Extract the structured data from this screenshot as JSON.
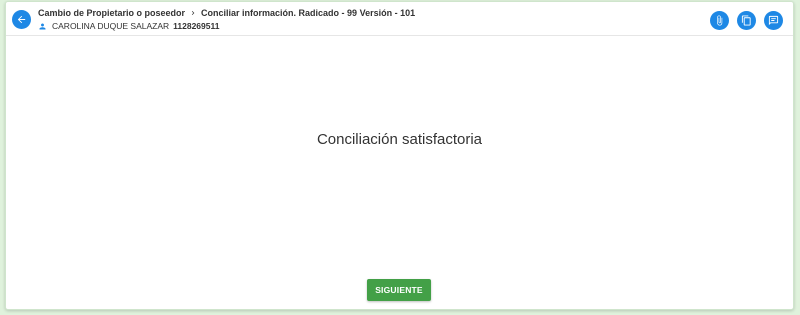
{
  "header": {
    "breadcrumb": {
      "first": "Cambio de Propietario o poseedor",
      "second": "Conciliar información. Radicado - 99 Versión - 101"
    },
    "user": {
      "name": "CAROLINA DUQUE SALAZAR",
      "document": "1128269511"
    },
    "icons": {
      "back": "arrow-left-icon",
      "attach": "paperclip-icon",
      "copy": "copy-icon",
      "comment": "comment-icon",
      "user": "person-icon",
      "separator": "chevron-right-icon"
    }
  },
  "main": {
    "message": "Conciliación satisfactoria",
    "next_label": "SIGUIENTE"
  },
  "colors": {
    "accent": "#1e88e5",
    "success": "#43a047",
    "background": "#dff2dc"
  }
}
